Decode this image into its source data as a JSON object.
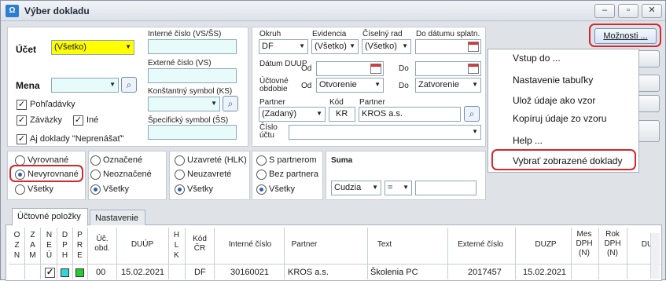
{
  "window": {
    "title": "Výber dokladu",
    "app_icon": "app-icon",
    "minimize": "–",
    "maximize": "▫",
    "close": "✕"
  },
  "filters": {
    "ucet_label": "Účet",
    "ucet_value": "(Všetko)",
    "mena_label": "Mena",
    "mena_value": "",
    "checkboxes": [
      {
        "label": "Pohľadávky",
        "checked": true
      },
      {
        "label": "Záväzky",
        "checked": true
      },
      {
        "label": "Iné",
        "checked": true
      },
      {
        "label": "Aj doklady \"Neprenášať\"",
        "checked": true
      }
    ],
    "interne_label": "Interné číslo (VS/ŠS)",
    "externe_label": "Externé číslo (VS)",
    "konst_label": "Konštantný symbol (KS)",
    "specif_label": "Špecifický symbol (ŠS)"
  },
  "rightfilters": {
    "okruh_label": "Okruh",
    "okruh_value": "DF",
    "evidencia_label": "Evidencia",
    "evidencia_value": "(Všetko)",
    "ciselny_label": "Číselný rad",
    "ciselny_value": "(Všetko)",
    "datum_splat_label": "Do dátumu splatn.",
    "datum_duup_label": "Dátum DUUP",
    "od_label": "Od",
    "do_label": "Do",
    "uctovne_label": "Účtovné obdobie",
    "obdobie_od": "Otvorenie",
    "obdobie_do": "Zatvorenie",
    "partner_label": "Partner",
    "kod_label": "Kód",
    "partner_name_label": "Partner",
    "partner_value": "(Zadaný)",
    "kod_value": "KR",
    "partner_name_value": "KROS a.s.",
    "cislo_uctu_label": "Číslo účtu"
  },
  "radios": {
    "g1": [
      {
        "label": "Vyrovnané",
        "on": false
      },
      {
        "label": "Nevyrovnané",
        "on": true
      },
      {
        "label": "Všetky",
        "on": false
      }
    ],
    "g2": [
      {
        "label": "Označené",
        "on": false
      },
      {
        "label": "Neoznačené",
        "on": false
      },
      {
        "label": "Všetky",
        "on": true
      }
    ],
    "g3": [
      {
        "label": "Uzavreté (HLK)",
        "on": false
      },
      {
        "label": "Neuzavreté",
        "on": false
      },
      {
        "label": "Všetky",
        "on": true
      }
    ],
    "g4": [
      {
        "label": "S partnerom",
        "on": false
      },
      {
        "label": "Bez partnera",
        "on": false
      },
      {
        "label": "Všetky",
        "on": true
      }
    ],
    "suma_label": "Suma",
    "suma_currency": "Cudzia",
    "suma_op": "="
  },
  "moznosti_label": "Možnosti ...",
  "menu": [
    "Vstup do ...",
    "Nastavenie tabuľky",
    "Ulož údaje ako vzor",
    "Kopíruj údaje zo vzoru",
    "Help ...",
    "Vybrať zobrazené doklady"
  ],
  "tabs": [
    "Účtovné položky",
    "Nastavenie"
  ],
  "table": {
    "headers": [
      "O Z N",
      "Z A M",
      "N E Ú",
      "D P H",
      "P R E",
      "Úč. obd.",
      "DUÚP",
      "H L K",
      "Kód ČR",
      "Interné číslo",
      "Partner",
      "Text",
      "Externé číslo",
      "DUZP",
      "Mes DPH (N)",
      "Rok DPH (N)",
      "DU"
    ],
    "row": [
      "",
      "",
      "✓",
      "",
      "",
      "00",
      "15.02.2021",
      "",
      "DF",
      "30160021",
      "KROS a.s.",
      "Školenia PC",
      "2017457",
      "15.02.2021",
      "",
      "",
      ""
    ],
    "dph_color": "#33d6d6",
    "pre_color": "#22cc33"
  }
}
